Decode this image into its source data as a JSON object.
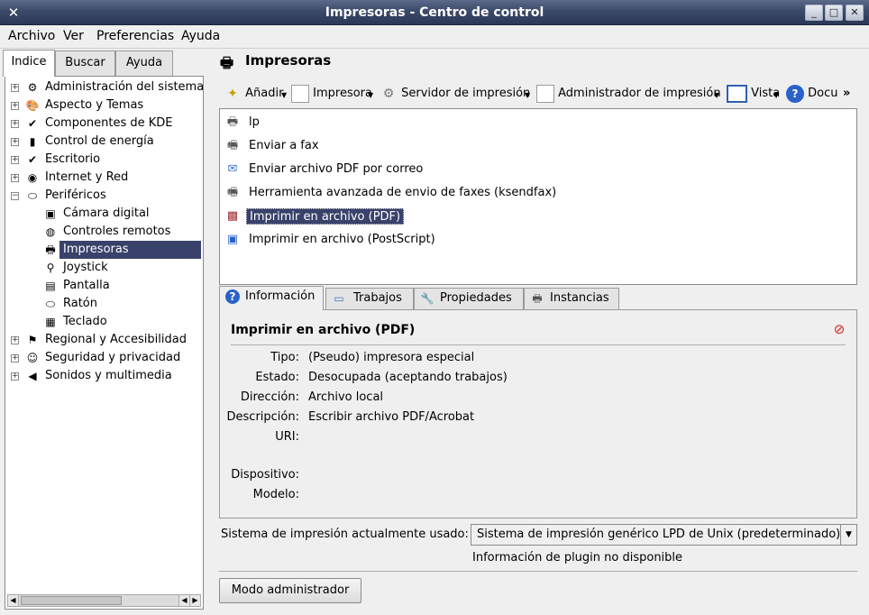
{
  "window": {
    "title": "Impresoras - Centro de control",
    "app_icon": "tools-icon",
    "buttons": [
      "minimize",
      "maximize",
      "close"
    ]
  },
  "menu": [
    "Archivo",
    "Ver",
    "Preferencias",
    "Ayuda"
  ],
  "left_tabs": [
    "Indice",
    "Buscar",
    "Ayuda"
  ],
  "tree": [
    {
      "label": "Administración del sistema",
      "icon": "gear-icon",
      "expander": "+"
    },
    {
      "label": "Aspecto y Temas",
      "icon": "palette-icon",
      "expander": "+"
    },
    {
      "label": "Componentes de KDE",
      "icon": "components-icon",
      "expander": "+"
    },
    {
      "label": "Control de energía",
      "icon": "battery-icon",
      "expander": "+"
    },
    {
      "label": "Escritorio",
      "icon": "desktop-icon",
      "expander": "+"
    },
    {
      "label": "Internet y Red",
      "icon": "globe-icon",
      "expander": "+"
    },
    {
      "label": "Periféricos",
      "icon": "mouse-icon",
      "expander": "−"
    },
    {
      "label": "Cámara digital",
      "icon": "camera-icon",
      "child": true
    },
    {
      "label": "Controles remotos",
      "icon": "remote-icon",
      "child": true
    },
    {
      "label": "Impresoras",
      "icon": "printer-icon",
      "child": true,
      "selected": true
    },
    {
      "label": "Joystick",
      "icon": "joystick-icon",
      "child": true
    },
    {
      "label": "Pantalla",
      "icon": "monitor-icon",
      "child": true
    },
    {
      "label": "Ratón",
      "icon": "mouse-icon",
      "child": true
    },
    {
      "label": "Teclado",
      "icon": "keyboard-icon",
      "child": true
    },
    {
      "label": "Regional y Accesibilidad",
      "icon": "flag-icon",
      "expander": "+"
    },
    {
      "label": "Seguridad y privacidad",
      "icon": "user-lock-icon",
      "expander": "+"
    },
    {
      "label": "Sonidos y multimedia",
      "icon": "speaker-icon",
      "expander": "+"
    }
  ],
  "section": {
    "title": "Impresoras",
    "icon": "printer-icon"
  },
  "toolbar": {
    "add": "Añadir",
    "printer": "Impresora",
    "print_server": "Servidor de impresión",
    "print_manager": "Administrador de impresión",
    "view": "Vista",
    "docs": "Docu",
    "more": "»"
  },
  "printers": [
    {
      "label": "lp",
      "icon": "printer-icon"
    },
    {
      "label": "Enviar a fax",
      "icon": "fax-icon"
    },
    {
      "label": "Enviar archivo PDF por correo",
      "icon": "mail-icon"
    },
    {
      "label": "Herramienta avanzada de envio de faxes (ksendfax)",
      "icon": "fax-tool-icon"
    },
    {
      "label": "Imprimir en archivo (PDF)",
      "icon": "pdf-icon",
      "selected": true
    },
    {
      "label": "Imprimir en archivo (PostScript)",
      "icon": "save-icon"
    }
  ],
  "detail_tabs": [
    {
      "label": "Información",
      "icon": "help-icon"
    },
    {
      "label": "Trabajos",
      "icon": "folder-icon"
    },
    {
      "label": "Propiedades",
      "icon": "wrench-icon"
    },
    {
      "label": "Instancias",
      "icon": "printer-icon"
    }
  ],
  "info": {
    "title": "Imprimir en archivo (PDF)",
    "title_icon": "pdf-icon",
    "fields": [
      {
        "key": "Tipo:",
        "value": "(Pseudo) impresora especial"
      },
      {
        "key": "Estado:",
        "value": "Desocupada (aceptando trabajos)"
      },
      {
        "key": "Dirección:",
        "value": "Archivo local"
      },
      {
        "key": "Descripción:",
        "value": "Escribir archivo PDF/Acrobat"
      },
      {
        "key": "URI:",
        "value": ""
      },
      {
        "key": "Dispositivo:",
        "value": ""
      },
      {
        "key": "Modelo:",
        "value": ""
      }
    ]
  },
  "print_system": {
    "label": "Sistema de impresión actualmente usado:",
    "value": "Sistema de impresión genérico LPD de Unix (predeterminado)",
    "plugin_info": "Información de plugin no disponible"
  },
  "admin_button": "Modo administrador"
}
